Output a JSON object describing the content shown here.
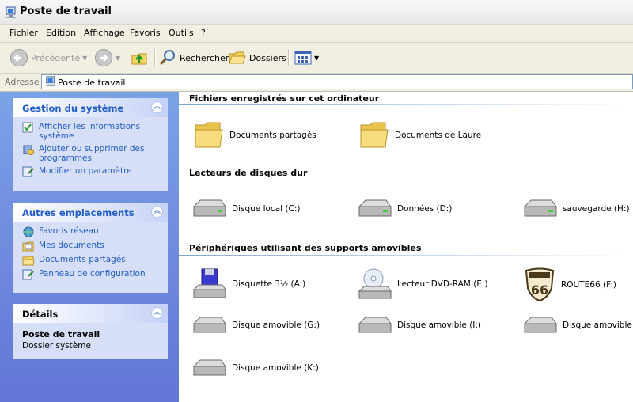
{
  "window": {
    "title": "Poste de travail"
  },
  "menu": [
    "Fichier",
    "Edition",
    "Affichage",
    "Favoris",
    "Outils",
    "?"
  ],
  "toolbar": {
    "back": "Précédente",
    "search": "Rechercher",
    "folders": "Dossiers"
  },
  "address": {
    "label": "Adresse",
    "value": "Poste de travail"
  },
  "sidebar": {
    "system": {
      "title": "Gestion du système",
      "items": [
        "Afficher les informations système",
        "Ajouter ou supprimer des programmes",
        "Modifier un paramètre"
      ]
    },
    "places": {
      "title": "Autres emplacements",
      "items": [
        "Favoris réseau",
        "Mes documents",
        "Documents partagés",
        "Panneau de configuration"
      ]
    },
    "details": {
      "title": "Détails",
      "name": "Poste de travail",
      "type": "Dossier système"
    }
  },
  "groups": {
    "files": {
      "title": "Fichiers enregistrés sur cet ordinateur",
      "items": [
        "Documents partagés",
        "Documents de Laure"
      ]
    },
    "hdd": {
      "title": "Lecteurs de disques dur",
      "items": [
        "Disque local (C:)",
        "Données (D:)",
        "sauvegarde (H:)"
      ]
    },
    "removable": {
      "title": "Périphériques utilisant des supports amovibles",
      "items": [
        "Disquette 3½ (A:)",
        "Lecteur DVD-RAM (E:)",
        "ROUTE66 (F:)",
        "Disque amovible (G:)",
        "Disque amovible (I:)",
        "Disque amovible (J:)",
        "Disque amovible (K:)"
      ]
    }
  },
  "colors": {
    "task_link": "#215dc6",
    "sidebar_bg": "#6f8fe0"
  }
}
